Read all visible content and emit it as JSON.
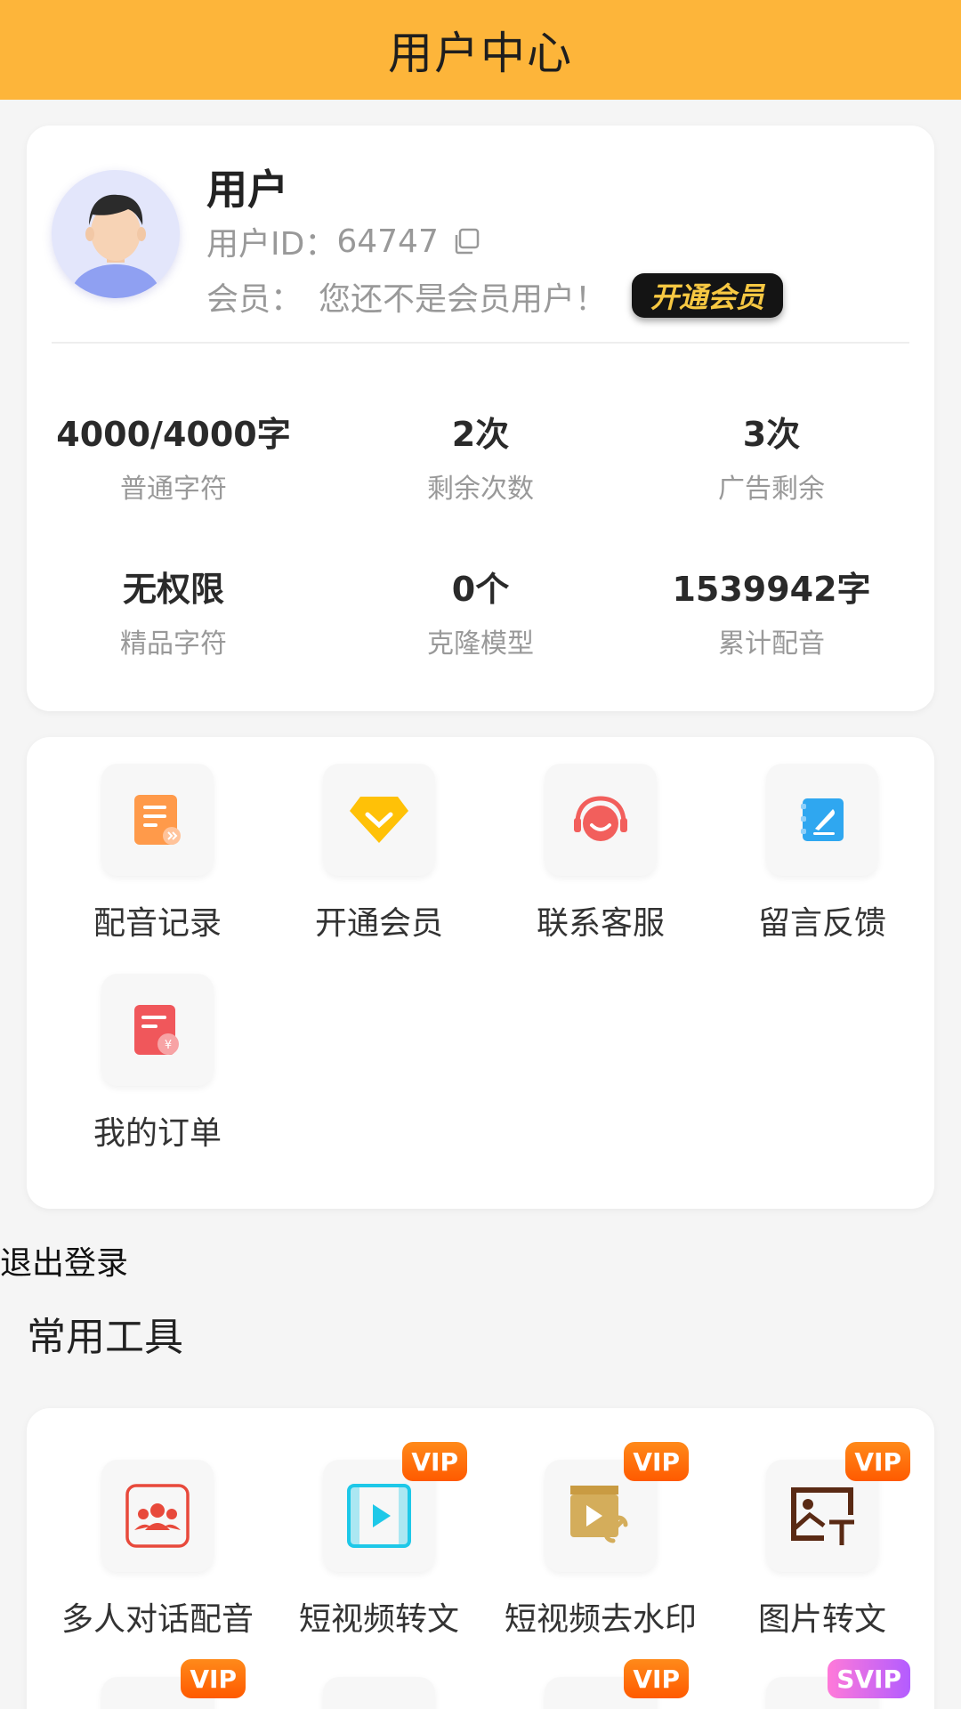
{
  "header": {
    "title": "用户中心"
  },
  "profile": {
    "name": "用户",
    "id_label": "用户ID：",
    "id_value": "64747",
    "member_label": "会员：",
    "member_value": "您还不是会员用户！",
    "vip_button": "开通会员"
  },
  "stats": [
    {
      "value": "4000/4000字",
      "label": "普通字符"
    },
    {
      "value": "2次",
      "label": "剩余次数"
    },
    {
      "value": "3次",
      "label": "广告剩余"
    },
    {
      "value": "无权限",
      "label": "精品字符"
    },
    {
      "value": "0个",
      "label": "克隆模型"
    },
    {
      "value": "1539942字",
      "label": "累计配音"
    }
  ],
  "menu": [
    {
      "label": "配音记录",
      "icon": "record-icon"
    },
    {
      "label": "开通会员",
      "icon": "diamond-icon"
    },
    {
      "label": "联系客服",
      "icon": "headset-icon"
    },
    {
      "label": "留言反馈",
      "icon": "feedback-icon"
    },
    {
      "label": "我的订单",
      "icon": "order-icon"
    }
  ],
  "logout": "退出登录",
  "tools_section": {
    "title": "常用工具"
  },
  "tools": [
    {
      "label": "多人对话配音",
      "icon": "group-chat-icon",
      "badge": ""
    },
    {
      "label": "短视频转文",
      "icon": "video-text-icon",
      "badge": "VIP"
    },
    {
      "label": "短视频去水印",
      "icon": "video-link-icon",
      "badge": "VIP"
    },
    {
      "label": "图片转文",
      "icon": "image-text-icon",
      "badge": "VIP"
    }
  ],
  "tools_row2_badges": [
    "VIP",
    "",
    "VIP",
    "SVIP"
  ],
  "colors": {
    "header": "#FDB53A",
    "vip_text": "#F7C842",
    "badge": "#FF6A00"
  }
}
